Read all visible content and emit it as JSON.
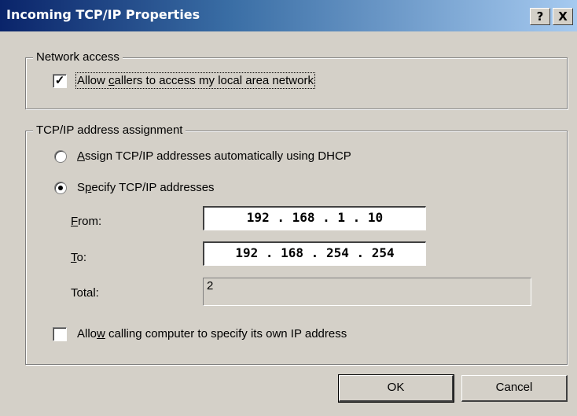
{
  "window": {
    "title": "Incoming TCP/IP Properties",
    "help_glyph": "?",
    "close_glyph": "X"
  },
  "network_access": {
    "legend": "Network access",
    "allow_callers": {
      "checked": true,
      "check_glyph": "✓",
      "label_pre": "Allow ",
      "label_mnemonic": "c",
      "label_post": "allers to access my local area network"
    }
  },
  "address_assignment": {
    "legend": "TCP/IP address assignment",
    "dhcp_option": {
      "selected": false,
      "label_mnemonic": "A",
      "label_post": "ssign TCP/IP addresses automatically using DHCP"
    },
    "specify_option": {
      "selected": true,
      "label_pre": "S",
      "label_mnemonic": "p",
      "label_post": "ecify TCP/IP addresses"
    },
    "from": {
      "label_mnemonic": "F",
      "label_post": "rom:",
      "value": "192 . 168 . 1 . 10"
    },
    "to": {
      "label_mnemonic": "T",
      "label_post": "o:",
      "value": "192 . 168 . 254 . 254"
    },
    "total": {
      "label": "Total:",
      "value": "2"
    },
    "allow_own_ip": {
      "checked": false,
      "label_pre": "Allo",
      "label_mnemonic": "w",
      "label_post": " calling computer to specify its own IP address"
    }
  },
  "buttons": {
    "ok_label": "OK",
    "cancel_label": "Cancel"
  }
}
